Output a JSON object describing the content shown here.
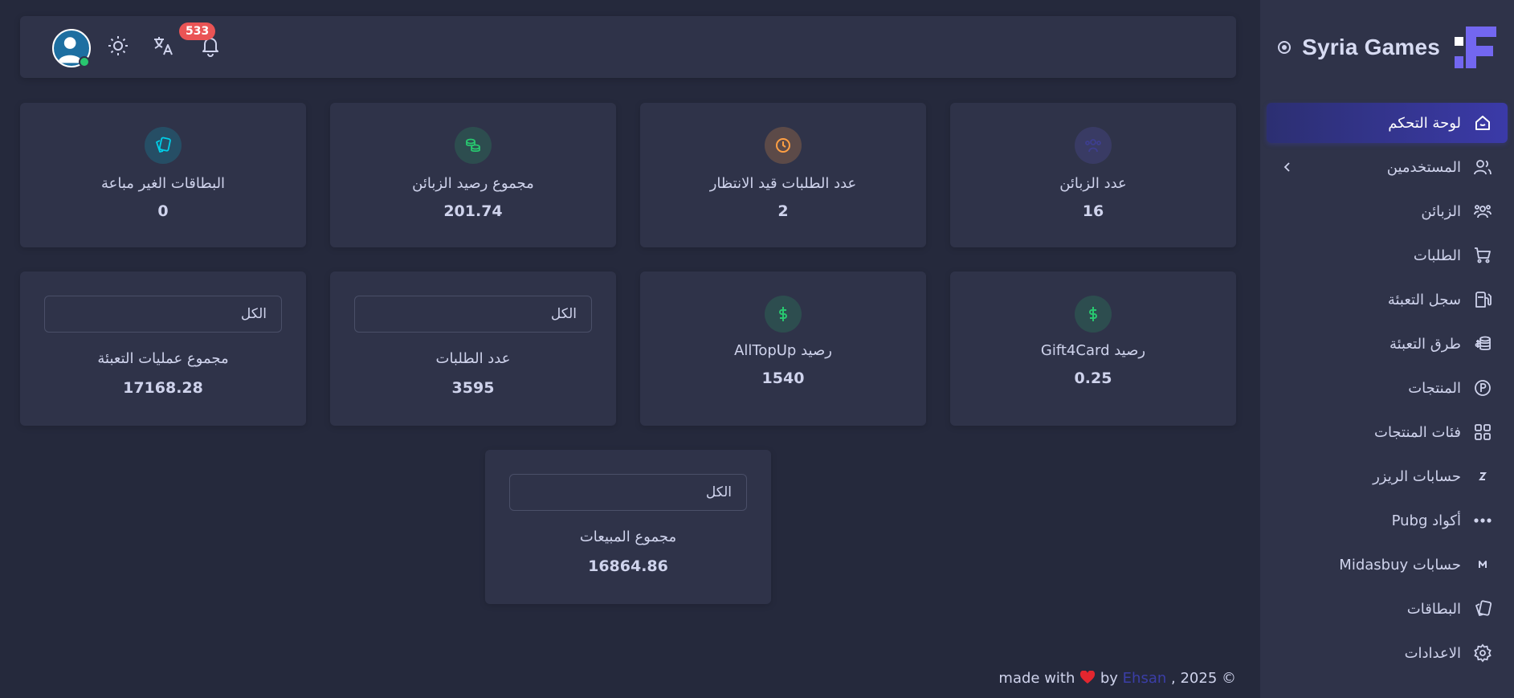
{
  "brand": {
    "name": "Syria Games"
  },
  "sidebar": {
    "items": [
      {
        "label": "لوحة التحكم",
        "icon": "home-icon",
        "active": true
      },
      {
        "label": "المستخدمين",
        "icon": "users-icon",
        "has_submenu": true
      },
      {
        "label": "الزبائن",
        "icon": "customers-icon"
      },
      {
        "label": "الطلبات",
        "icon": "cart-icon"
      },
      {
        "label": "سجل التعبئة",
        "icon": "fuel-icon"
      },
      {
        "label": "طرق التعبئة",
        "icon": "coins-icon"
      },
      {
        "label": "المنتجات",
        "icon": "p-circle-icon"
      },
      {
        "label": "فئات المنتجات",
        "icon": "grid-icon"
      },
      {
        "label": "حسابات الريزر",
        "icon": "z-letter-icon"
      },
      {
        "label": "أكواد Pubg",
        "icon": "dots-icon"
      },
      {
        "label": "حسابات Midasbuy",
        "icon": "m-letter-icon"
      },
      {
        "label": "البطاقات",
        "icon": "cards-icon"
      },
      {
        "label": "الاعدادات",
        "icon": "settings-icon"
      }
    ]
  },
  "navbar": {
    "notifications_count": "533"
  },
  "stats": [
    {
      "label": "عدد الزبائن",
      "value": "16",
      "icon": "users-group-icon",
      "color": "#7367f0"
    },
    {
      "label": "عدد الطلبات قيد الانتظار",
      "value": "2",
      "icon": "clock-icon",
      "color": "#ff9f43"
    },
    {
      "label": "مجموع رصيد الزبائن",
      "value": "201.74",
      "icon": "coins-icon",
      "color": "#28c76f"
    },
    {
      "label": "البطاقات الغير مباعة",
      "value": "0",
      "icon": "cards-icon",
      "color": "#00cfe8"
    },
    {
      "label": "رصيد Gift4Card",
      "value": "0.25",
      "icon": "dollar-icon",
      "color": "#28c76f"
    },
    {
      "label": "رصيد AllTopUp",
      "value": "1540",
      "icon": "dollar-icon",
      "color": "#28c76f"
    },
    {
      "label": "عدد الطلبات",
      "value": "3595",
      "filter": "الكل"
    },
    {
      "label": "مجموع عمليات التعبئة",
      "value": "17168.28",
      "filter": "الكل"
    },
    {
      "label": "مجموع المبيعات",
      "value": "16864.86",
      "filter": "الكل"
    }
  ],
  "footer": {
    "prefix": "made with",
    "by": "by",
    "author": "Ehsan",
    "year": ", 2025 ©"
  }
}
